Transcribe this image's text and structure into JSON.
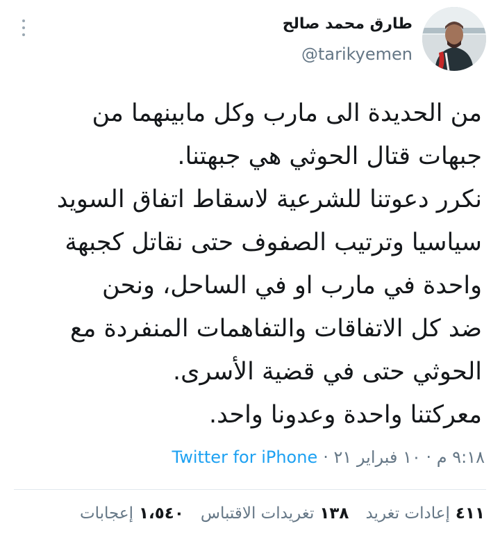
{
  "author": {
    "display_name": "طارق محمد صالح",
    "handle": "@tarikyemen"
  },
  "tweet": {
    "lines": [
      "من الحديدة الى مارب وكل مابينهما من",
      "جبهات قتال الحوثي هي جبهتنا.",
      "نكرر دعوتنا للشرعية لاسقاط اتفاق السويد",
      "سياسيا وترتيب الصفوف حتى نقاتل كجبهة",
      "واحدة في مارب او في الساحل، ونحن",
      "ضد كل الاتفاقات والتفاهمات المنفردة مع",
      "الحوثي حتى في قضية الأسرى.",
      "معركتنا واحدة وعدونا واحد."
    ],
    "timestamp": "٩:١٨ م · ١٠ فبراير ٢١ ·",
    "source": "Twitter for iPhone"
  },
  "stats": {
    "retweets": {
      "count": "٤١١",
      "label": "إعادات تغريد"
    },
    "quotes": {
      "count": "١٣٨",
      "label": "تغريدات الاقتباس"
    },
    "likes": {
      "count": "١،٥٤٠",
      "label": "إعجابات"
    }
  },
  "icons": {
    "more": "more-vertical-icon"
  },
  "colors": {
    "link": "#1da1f2",
    "secondary": "#657786",
    "text": "#14171a",
    "divider": "#e1e8ed"
  }
}
